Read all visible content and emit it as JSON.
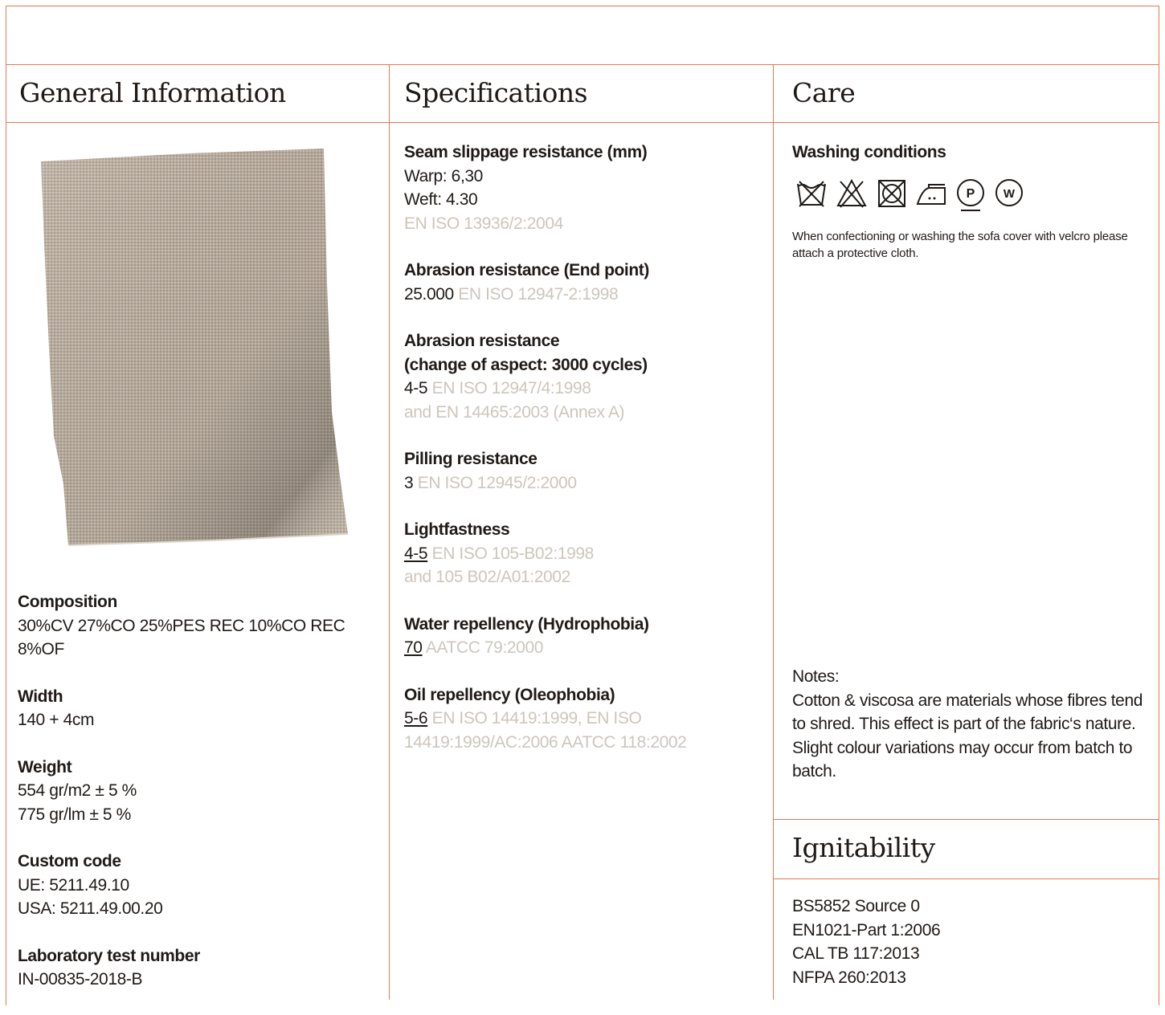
{
  "general": {
    "heading": "General Information",
    "swatch_icon": "fabric-swatch",
    "composition": {
      "label": "Composition",
      "value": "30%CV 27%CO 25%PES REC 10%CO REC 8%OF"
    },
    "width": {
      "label": "Width",
      "value": "140 + 4cm"
    },
    "weight": {
      "label": "Weight",
      "lines": [
        "554 gr/m2 ± 5 %",
        "775 gr/lm ± 5 %"
      ]
    },
    "custom_code": {
      "label": "Custom code",
      "lines": [
        "UE: 5211.49.10",
        "USA: 5211.49.00.20"
      ]
    },
    "lab_test": {
      "label": "Laboratory test number",
      "value": "IN-00835-2018-B"
    }
  },
  "specifications": {
    "heading": "Specifications",
    "seam": {
      "label": "Seam slippage resistance (mm)",
      "warp": "Warp: 6,30",
      "weft": "Weft: 4.30",
      "standard": "EN ISO 13936/2:2004"
    },
    "abrasion_end": {
      "label": "Abrasion resistance (End point)",
      "value": "25.000",
      "standard": "EN ISO 12947-2:1998"
    },
    "abrasion_aspect": {
      "label_1": "Abrasion resistance",
      "label_2": "(change of aspect: 3000 cycles)",
      "value": "4-5",
      "standard_1": "EN ISO 12947/4:1998",
      "standard_2": "and EN 14465:2003 (Annex A)"
    },
    "pilling": {
      "label": "Pilling resistance",
      "value": "3",
      "standard": "EN ISO 12945/2:2000"
    },
    "lightfastness": {
      "label": "Lightfastness",
      "value": "4-5",
      "standard_1": "EN ISO 105-B02:1998",
      "standard_2": "and 105 B02/A01:2002"
    },
    "water": {
      "label": "Water repellency (Hydrophobia)",
      "value": "70",
      "standard": "AATCC 79:2000"
    },
    "oil": {
      "label": "Oil repellency (Oleophobia)",
      "value": "5-6",
      "standard_1": "EN ISO 14419:1999, EN ISO",
      "standard_2": "14419:1999/AC:2006 AATCC 118:2002"
    }
  },
  "care": {
    "heading": "Care",
    "washing_label": "Washing conditions",
    "symbols": [
      {
        "icon": "do-not-wash-icon"
      },
      {
        "icon": "do-not-bleach-icon"
      },
      {
        "icon": "do-not-tumble-dry-icon"
      },
      {
        "icon": "iron-low-icon"
      },
      {
        "icon": "dry-clean-p-gentle-icon",
        "letter": "P"
      },
      {
        "icon": "wet-clean-w-icon",
        "letter": "W"
      }
    ],
    "velcro_note": "When confectioning or washing the sofa cover with velcro please attach a protective cloth.",
    "notes_title": "Notes:",
    "notes_1": "Cotton & viscosa are materials whose fibres tend to shred. This effect is part of the fabric‘s nature.",
    "notes_2": "Slight colour variations may occur from batch to batch."
  },
  "ignitability": {
    "heading": "Ignitability",
    "items": [
      "BS5852 Source 0",
      "EN1021-Part 1:2006",
      "CAL TB 117:2013",
      "NFPA 260:2013"
    ]
  },
  "colors": {
    "accent": "#e07a54",
    "standard_text": "#cdc6bd",
    "text": "#1f1a17"
  }
}
